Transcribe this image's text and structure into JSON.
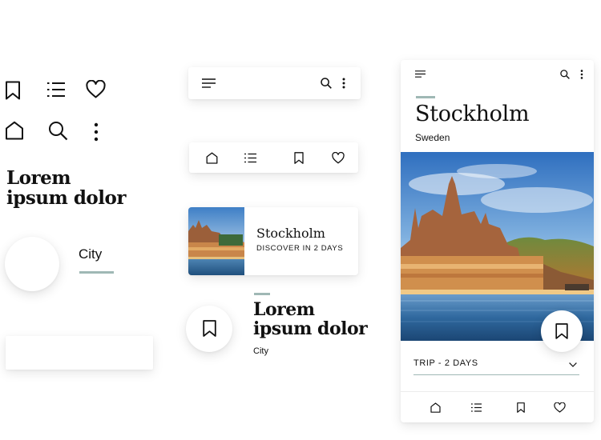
{
  "colors": {
    "accent": "#9fb8b5",
    "text": "#111111",
    "water": "#2e6a9a",
    "divider": "#9fb8b5"
  },
  "left_column": {
    "icons": [
      "bookmark-icon",
      "list-icon",
      "heart-icon",
      "home-icon",
      "search-icon",
      "more-vert-icon"
    ],
    "heading": [
      "Lorem",
      "ipsum dolor"
    ],
    "city_label": "City"
  },
  "middle_column": {
    "top_bar_icons": [
      "menu-icon",
      "search-icon",
      "more-vert-icon"
    ],
    "nav_icons": [
      "home-icon",
      "list-icon",
      "bookmark-icon",
      "heart-icon"
    ],
    "destination_card": {
      "title": "Stockholm",
      "subtitle": "DISCOVER IN 2 DAYS"
    },
    "heading": [
      "Lorem",
      "ipsum dolor"
    ],
    "city_label": "City"
  },
  "phone": {
    "title": "Stockholm",
    "subtitle": "Sweden",
    "trip_label": "TRIP - 2 DAYS",
    "nav_icons": [
      "home-icon",
      "list-icon",
      "bookmark-icon",
      "heart-icon"
    ]
  }
}
